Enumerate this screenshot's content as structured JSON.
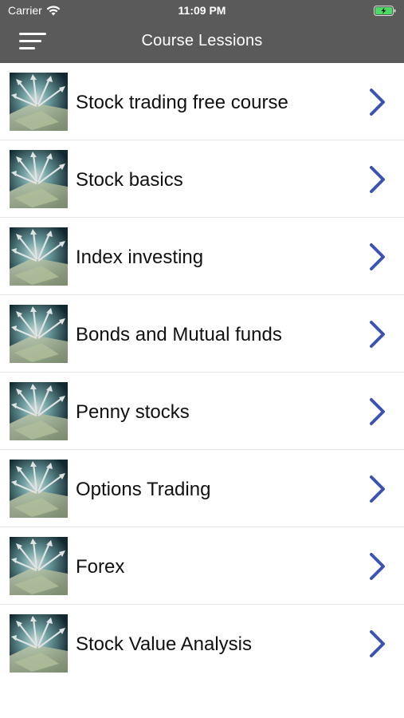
{
  "status_bar": {
    "carrier": "Carrier",
    "time": "11:09 PM",
    "icons": [
      "wifi-icon",
      "battery-charging-icon"
    ]
  },
  "nav": {
    "title": "Course Lessions",
    "menu_icon": "hamburger-menu-icon"
  },
  "colors": {
    "nav_background": "#5a5a5a",
    "chevron": "#3c53b1",
    "battery_fill": "#4cd964"
  },
  "lessons": [
    {
      "label": "Stock trading free course"
    },
    {
      "label": "Stock basics"
    },
    {
      "label": "Index investing"
    },
    {
      "label": "Bonds and Mutual funds"
    },
    {
      "label": "Penny stocks"
    },
    {
      "label": "Options Trading"
    },
    {
      "label": "Forex"
    },
    {
      "label": "Stock Value Analysis"
    }
  ]
}
